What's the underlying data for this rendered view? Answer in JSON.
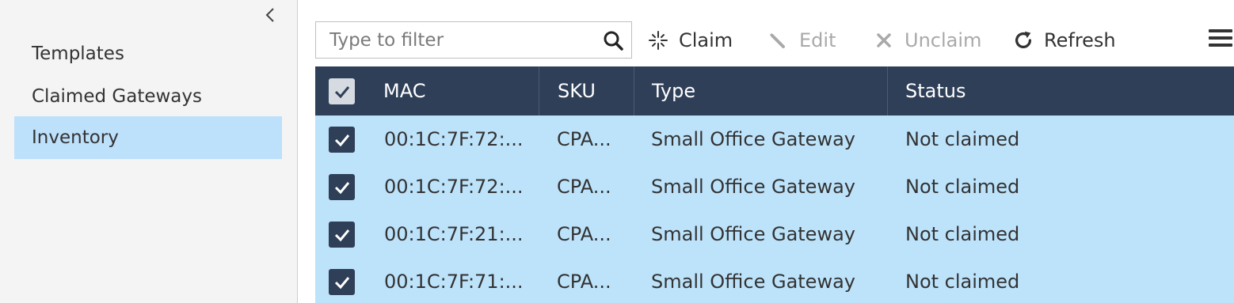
{
  "sidebar": {
    "items": [
      {
        "label": "Templates"
      },
      {
        "label": "Claimed Gateways"
      },
      {
        "label": "Inventory"
      }
    ]
  },
  "toolbar": {
    "filter_placeholder": "Type to filter",
    "filter_value": "",
    "claim_label": "Claim",
    "edit_label": "Edit",
    "unclaim_label": "Unclaim",
    "refresh_label": "Refresh"
  },
  "table": {
    "columns": [
      "MAC",
      "SKU",
      "Type",
      "Status"
    ],
    "rows": [
      {
        "mac": "00:1C:7F:72:...",
        "sku": "CPA...",
        "type": "Small Office Gateway",
        "status": "Not claimed"
      },
      {
        "mac": "00:1C:7F:72:...",
        "sku": "CPA...",
        "type": "Small Office Gateway",
        "status": "Not claimed"
      },
      {
        "mac": "00:1C:7F:21:...",
        "sku": "CPA...",
        "type": "Small Office Gateway",
        "status": "Not claimed"
      },
      {
        "mac": "00:1C:7F:71:...",
        "sku": "CPA...",
        "type": "Small Office Gateway",
        "status": "Not claimed"
      }
    ]
  },
  "colors": {
    "header_bg": "#2f3f58",
    "row_selected_bg": "#bde3fb",
    "sidebar_active_bg": "#bde0fb",
    "sidebar_bg": "#f4f4f4"
  }
}
